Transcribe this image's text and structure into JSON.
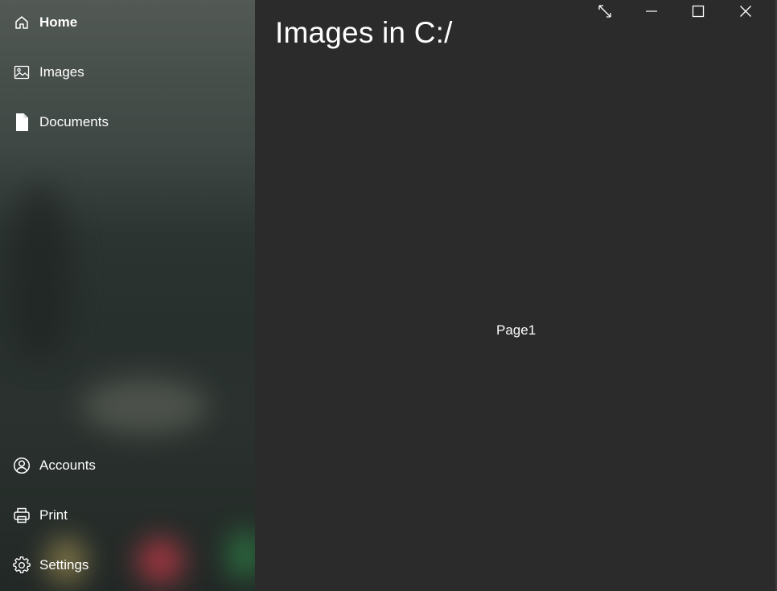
{
  "sidebar": {
    "items": [
      {
        "label": "Home",
        "icon": "home-icon",
        "active": true
      },
      {
        "label": "Images",
        "icon": "image-icon",
        "active": false
      },
      {
        "label": "Documents",
        "icon": "document-icon",
        "active": false
      }
    ],
    "footer_items": [
      {
        "label": "Accounts",
        "icon": "account-icon"
      },
      {
        "label": "Print",
        "icon": "print-icon"
      },
      {
        "label": "Settings",
        "icon": "gear-icon"
      }
    ]
  },
  "main": {
    "title": "Images in C:/",
    "content": "Page1"
  },
  "caption_buttons": {
    "icons": [
      "resize-icon",
      "minimize-icon",
      "maximize-icon",
      "close-icon"
    ]
  },
  "colors": {
    "background": "#2b2b2b",
    "text": "#ffffff"
  }
}
